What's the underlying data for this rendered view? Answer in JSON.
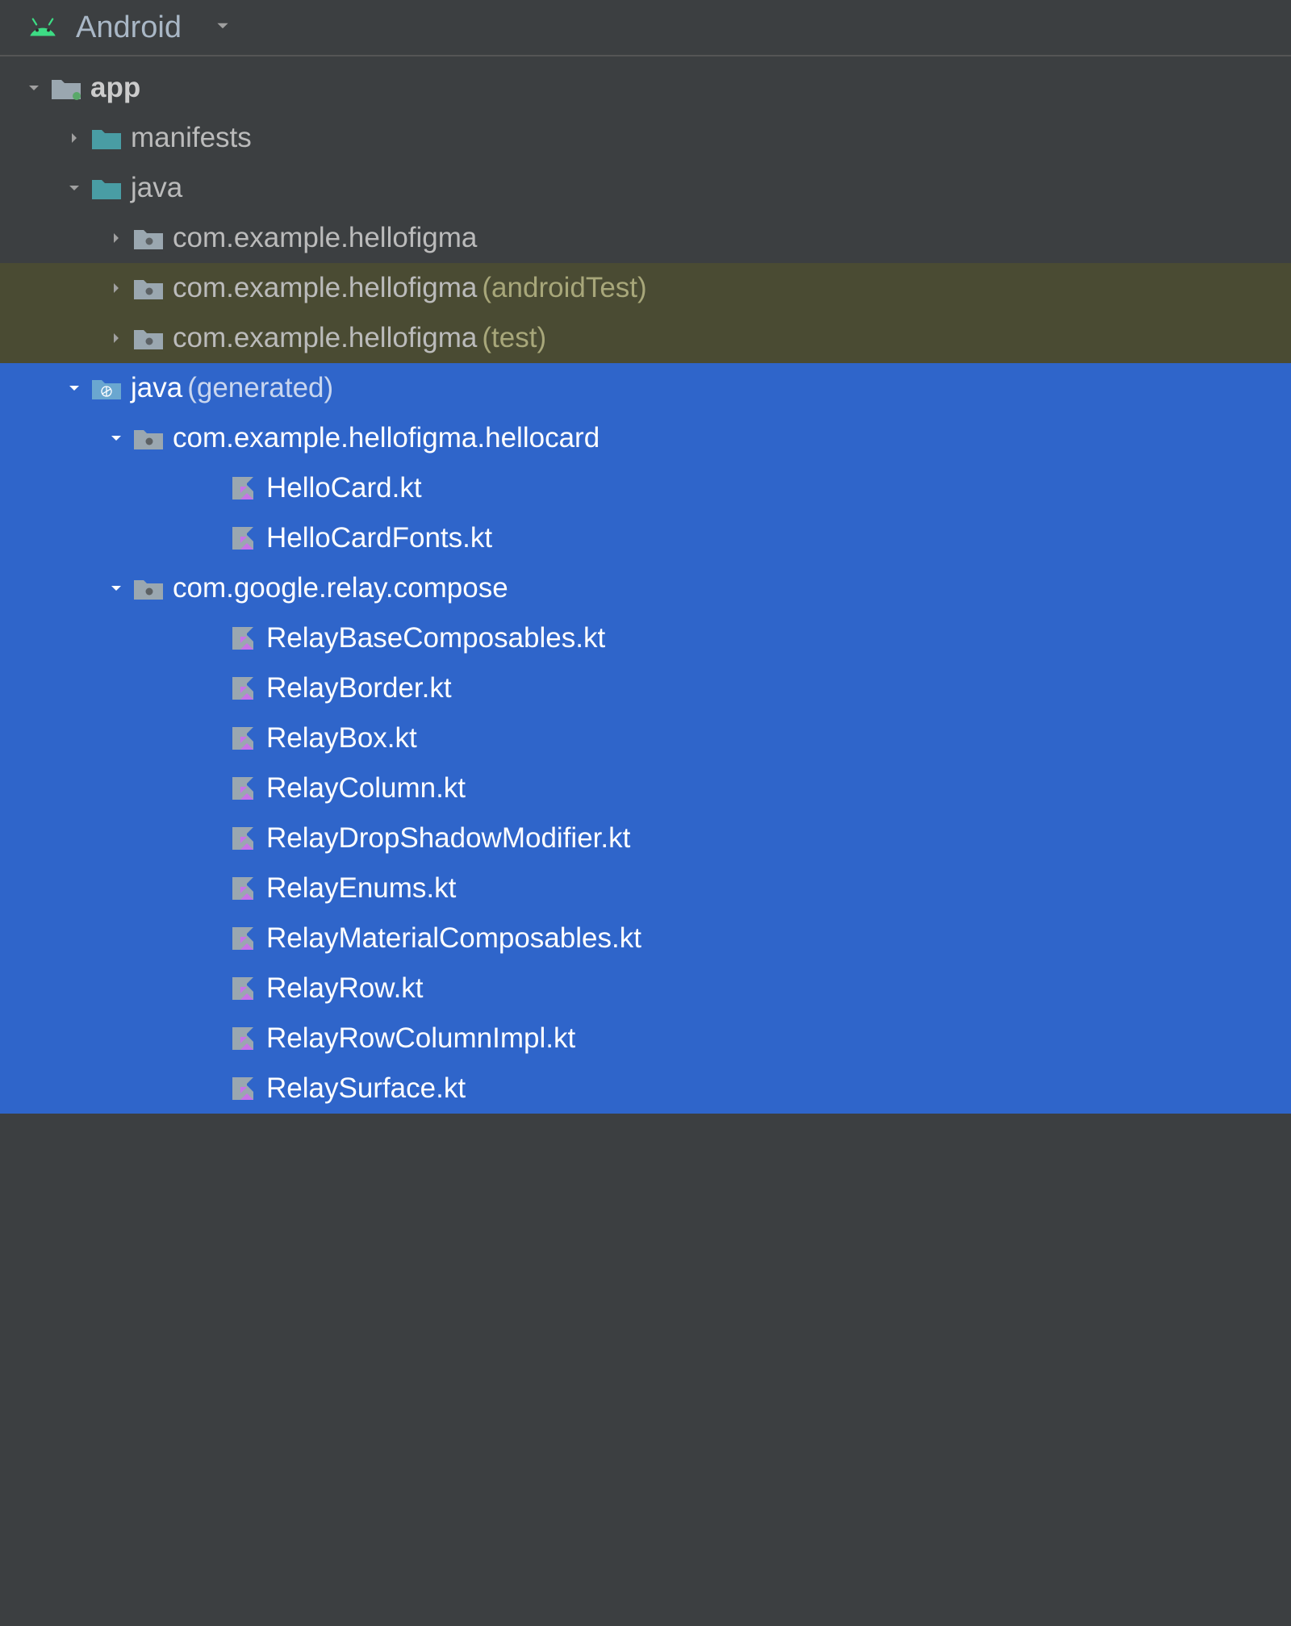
{
  "header": {
    "title": "Android"
  },
  "tree": {
    "app": "app",
    "manifests": "manifests",
    "java": "java",
    "pkg_main": "com.example.hellofigma",
    "pkg_androidtest": "com.example.hellofigma",
    "pkg_androidtest_suffix": "(androidTest)",
    "pkg_test": "com.example.hellofigma",
    "pkg_test_suffix": "(test)",
    "java_generated": "java",
    "java_generated_suffix": "(generated)",
    "pkg_hellocard": "com.example.hellofigma.hellocard",
    "file_hellocard": "HelloCard.kt",
    "file_hellocardfonts": "HelloCardFonts.kt",
    "pkg_relay": "com.google.relay.compose",
    "file_relaybasecomposables": "RelayBaseComposables.kt",
    "file_relayborder": "RelayBorder.kt",
    "file_relaybox": "RelayBox.kt",
    "file_relaycolumn": "RelayColumn.kt",
    "file_relaydrop": "RelayDropShadowModifier.kt",
    "file_relayenums": "RelayEnums.kt",
    "file_relaymaterial": "RelayMaterialComposables.kt",
    "file_relayrow": "RelayRow.kt",
    "file_relayrowcolumnimpl": "RelayRowColumnImpl.kt",
    "file_relaysurface": "RelaySurface.kt"
  }
}
